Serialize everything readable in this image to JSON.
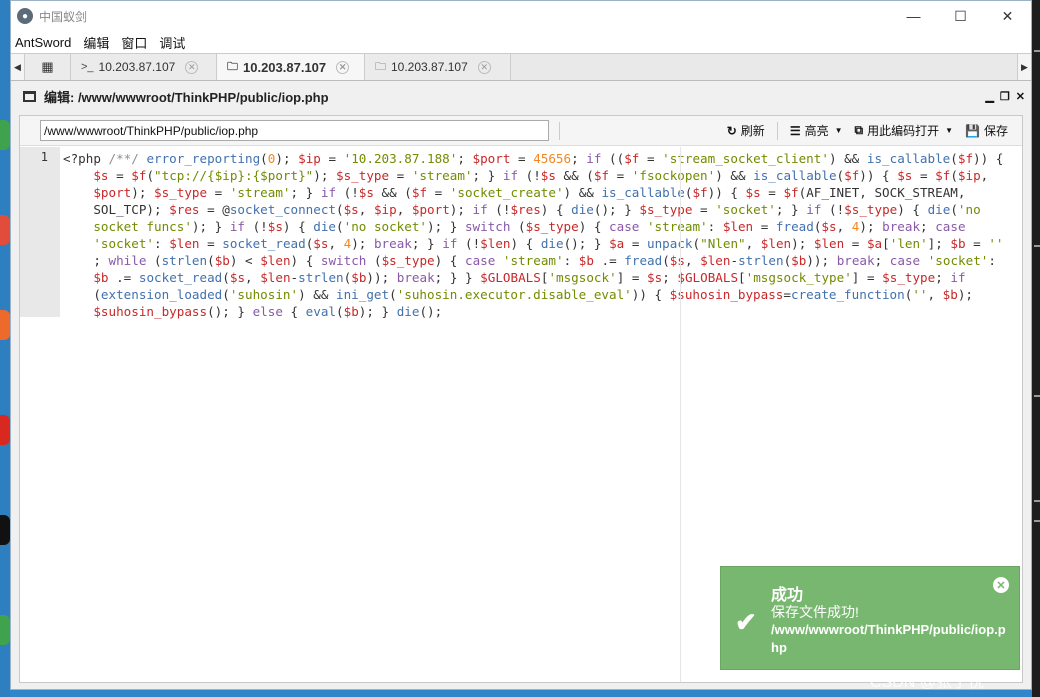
{
  "window": {
    "title": "中国蚁剑",
    "controls": [
      "—",
      "☐",
      "✕"
    ]
  },
  "menu": [
    "AntSword",
    "编辑",
    "窗口",
    "调试"
  ],
  "tabs": [
    {
      "icon": "terminal-icon",
      "glyph": ">_",
      "label": "10.203.87.107"
    },
    {
      "icon": "folder-icon",
      "glyph": "🗀",
      "label": "10.203.87.107"
    },
    {
      "icon": "folder-icon",
      "glyph": "🗀",
      "label": "10.203.87.107"
    }
  ],
  "panel": {
    "title": "编辑: /www/wwwroot/ThinkPHP/public/iop.php"
  },
  "toolbar": {
    "path_value": "/www/wwwroot/ThinkPHP/public/iop.php",
    "refresh": "刷新",
    "highlight": "高亮",
    "open_with_encoding": "用此编码打开",
    "save": "保存"
  },
  "editor": {
    "line_number": "1"
  },
  "toast": {
    "title": "成功",
    "message": "保存文件成功!",
    "path": "/www/wwwroot/ThinkPHP/public/iop.php"
  },
  "watermark": "CSDN @张子悦^^",
  "colors": {
    "toast_bg": "#78b76f",
    "keyword": "#8959a8",
    "function": "#4271ae",
    "variable": "#c82829",
    "string": "#718c00",
    "number": "#f5871f"
  }
}
